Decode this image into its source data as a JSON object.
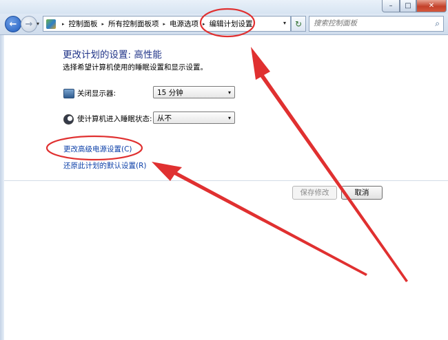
{
  "window": {
    "minimize_glyph": "–",
    "maximize_glyph": "□",
    "close_glyph": "✕"
  },
  "nav": {
    "back_glyph": "←",
    "forward_glyph": "→",
    "history_glyph": "▾",
    "breadcrumb": [
      "控制面板",
      "所有控制面板项",
      "电源选项",
      "编辑计划设置"
    ],
    "separator_glyph": "▸",
    "dropdown_glyph": "▾",
    "refresh_glyph": "↻",
    "search_placeholder": "搜索控制面板",
    "search_glyph": "⌕"
  },
  "plan": {
    "heading": "更改计划的设置: 高性能",
    "subheading": "选择希望计算机使用的睡眠设置和显示设置。",
    "display_label": "关闭显示器:",
    "display_value": "15 分钟",
    "sleep_label": "使计算机进入睡眠状态:",
    "sleep_value": "从不",
    "advanced_link": "更改高级电源设置(C)",
    "restore_link": "还原此计划的默认设置(R)"
  },
  "buttons": {
    "save": "保存修改",
    "cancel": "取消"
  },
  "icons": {
    "display": "monitor-icon",
    "sleep": "moon-icon",
    "address": "control-panel-icon",
    "search": "search-icon"
  },
  "colors": {
    "heading": "#1e3287",
    "link": "#0b3fa8",
    "annotation": "#e03030"
  }
}
